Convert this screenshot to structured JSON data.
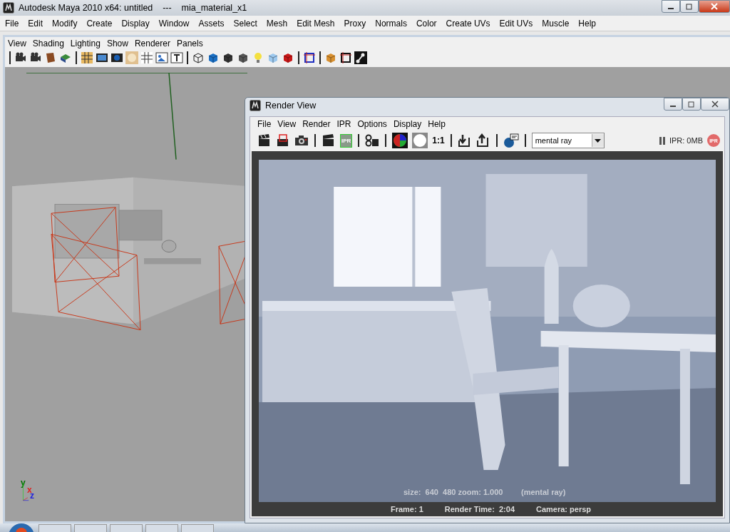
{
  "window": {
    "title": "Autodesk Maya 2010 x64: untitled    ---    mia_material_x1"
  },
  "menu": [
    "File",
    "Edit",
    "Modify",
    "Create",
    "Display",
    "Window",
    "Assets",
    "Select",
    "Mesh",
    "Edit Mesh",
    "Proxy",
    "Normals",
    "Color",
    "Create UVs",
    "Edit UVs",
    "Muscle",
    "Help"
  ],
  "panel_menu": [
    "View",
    "Shading",
    "Lighting",
    "Show",
    "Renderer",
    "Panels"
  ],
  "viewport": {
    "axis_labels": [
      "y",
      "x",
      "z"
    ]
  },
  "render_view": {
    "title": "Render View",
    "menu": [
      "File",
      "View",
      "Render",
      "IPR",
      "Options",
      "Display",
      "Help"
    ],
    "toolbar": {
      "ipr_icon_label": "IPR",
      "ratio_label": "1:1",
      "renderer": "mental ray",
      "ipr_memory": "IPR: 0MB",
      "ipr_stop_label": "IPR"
    },
    "image": {
      "info": "size:  640  480 zoom: 1.000",
      "renderer_note": "(mental ray)"
    },
    "status": {
      "frame": "Frame: 1",
      "render_time": "Render Time:  2:04",
      "camera": "Camera: persp"
    }
  }
}
